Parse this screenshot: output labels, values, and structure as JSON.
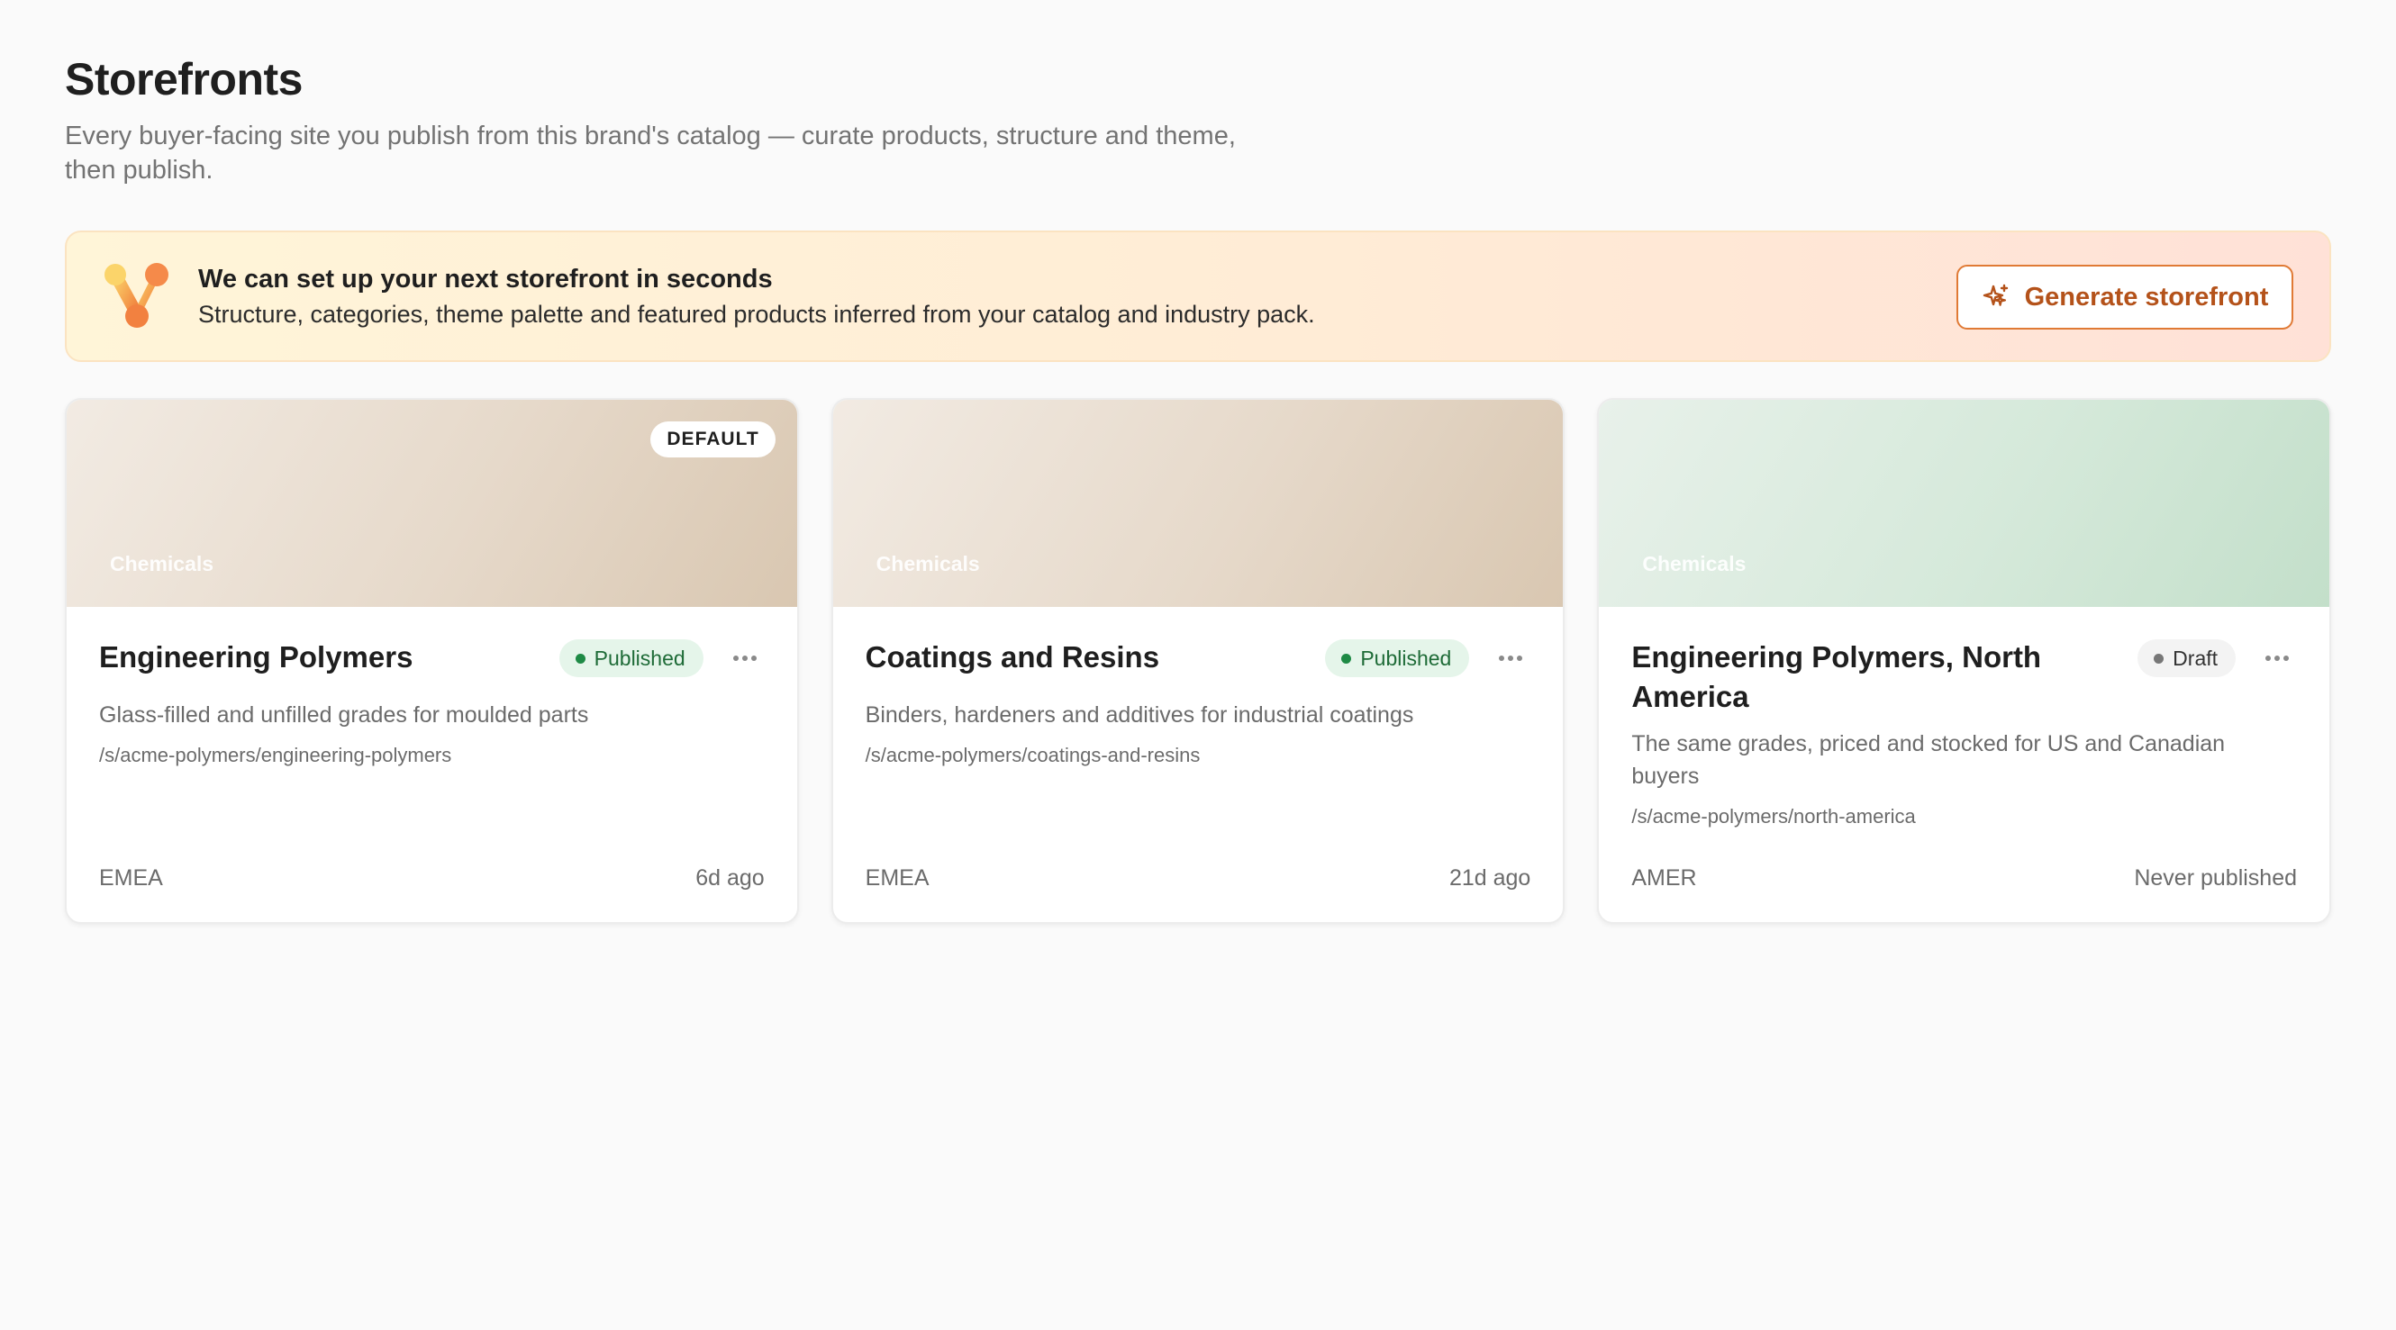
{
  "header": {
    "title": "Storefronts",
    "subtitle": "Every buyer-facing site you publish from this brand's catalog — curate products, structure and theme, then publish."
  },
  "banner": {
    "icon": "molecule-logo-icon",
    "title": "We can set up your next storefront in seconds",
    "description": "Structure, categories, theme palette and featured products inferred from your catalog and industry pack.",
    "button_label": "Generate storefront",
    "button_icon": "sparkle-icon"
  },
  "colors": {
    "accent": "#e07a35",
    "published_bg": "#e5f5ea",
    "published_dot": "#1e8a45",
    "draft_dot": "#777777"
  },
  "storefronts": [
    {
      "cover_label": "Chemicals",
      "badge": "DEFAULT",
      "title": "Engineering Polymers",
      "status": "Published",
      "description": "Glass-filled and unfilled grades for moulded parts",
      "path": "/s/acme-polymers/engineering-polymers",
      "region": "EMEA",
      "updated": "6d ago"
    },
    {
      "cover_label": "Chemicals",
      "title": "Coatings and Resins",
      "status": "Published",
      "description": "Binders, hardeners and additives for industrial coatings",
      "path": "/s/acme-polymers/coatings-and-resins",
      "region": "EMEA",
      "updated": "21d ago"
    },
    {
      "cover_label": "Chemicals",
      "title": "Engineering Polymers, North America",
      "status": "Draft",
      "description": "The same grades, priced and stocked for US and Canadian buyers",
      "path": "/s/acme-polymers/north-america",
      "region": "AMER",
      "updated": "Never published"
    }
  ]
}
